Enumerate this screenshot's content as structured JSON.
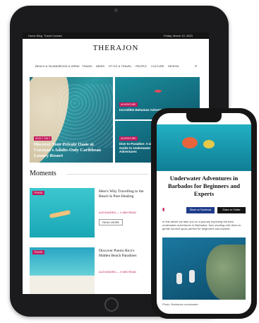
{
  "tablet": {
    "topbar_left": [
      "Home",
      "Blog",
      "Travel",
      "Contact"
    ],
    "topbar_right": "Friday, March 10, 2023",
    "logo": "THERAJON",
    "nav": [
      "BEACH & ISLANDS",
      "FOOD & DRINK",
      "TRAVEL",
      "NEWS",
      "STYLE & TRAVEL",
      "PEOPLE",
      "CULTURE",
      "DESIGN"
    ],
    "hero_main": {
      "tag": "ADULT ONLY",
      "title": "Discover Your Private Oasis at Curaçao's Adults-Only Caribbean Luxury Resort"
    },
    "hero_right_top": {
      "tag": "ADVENTURE",
      "title": "Incredible Bahamas Adventures"
    },
    "hero_right_bottom": {
      "tag": "ADVENTURE",
      "title": "Dive to Paradise: A Unique Guide to Underwater Adventures"
    },
    "section_title": "Moments",
    "cards": [
      {
        "tag": "TRAVEL",
        "title": "Here's Why Travelling to the Beach Is Pure Healing",
        "meta": "ALEXANDRA — 4 MIN READ",
        "button": "READ MORE"
      },
      {
        "tag": "TRAVEL",
        "title": "Discover Puerto Rico's Hidden Beach Paradises",
        "meta": "ALEXANDRA — 5 MIN READ"
      }
    ]
  },
  "phone": {
    "title": "Underwater Adventures in Barbados for Beginners and Experts",
    "share_facebook": "Share on Facebook",
    "share_twitter": "Share on Twitter",
    "body": "In this article we take you on a journey exploring the best underwater adventures in Barbados, from exciting reef dives to gentle snorkel spots perfect for beginners and experts.",
    "caption": "Photo: Barbados underwater"
  },
  "colors": {
    "accent": "#c2185b",
    "dark": "#141414",
    "ocean": "#1b8d9b"
  }
}
